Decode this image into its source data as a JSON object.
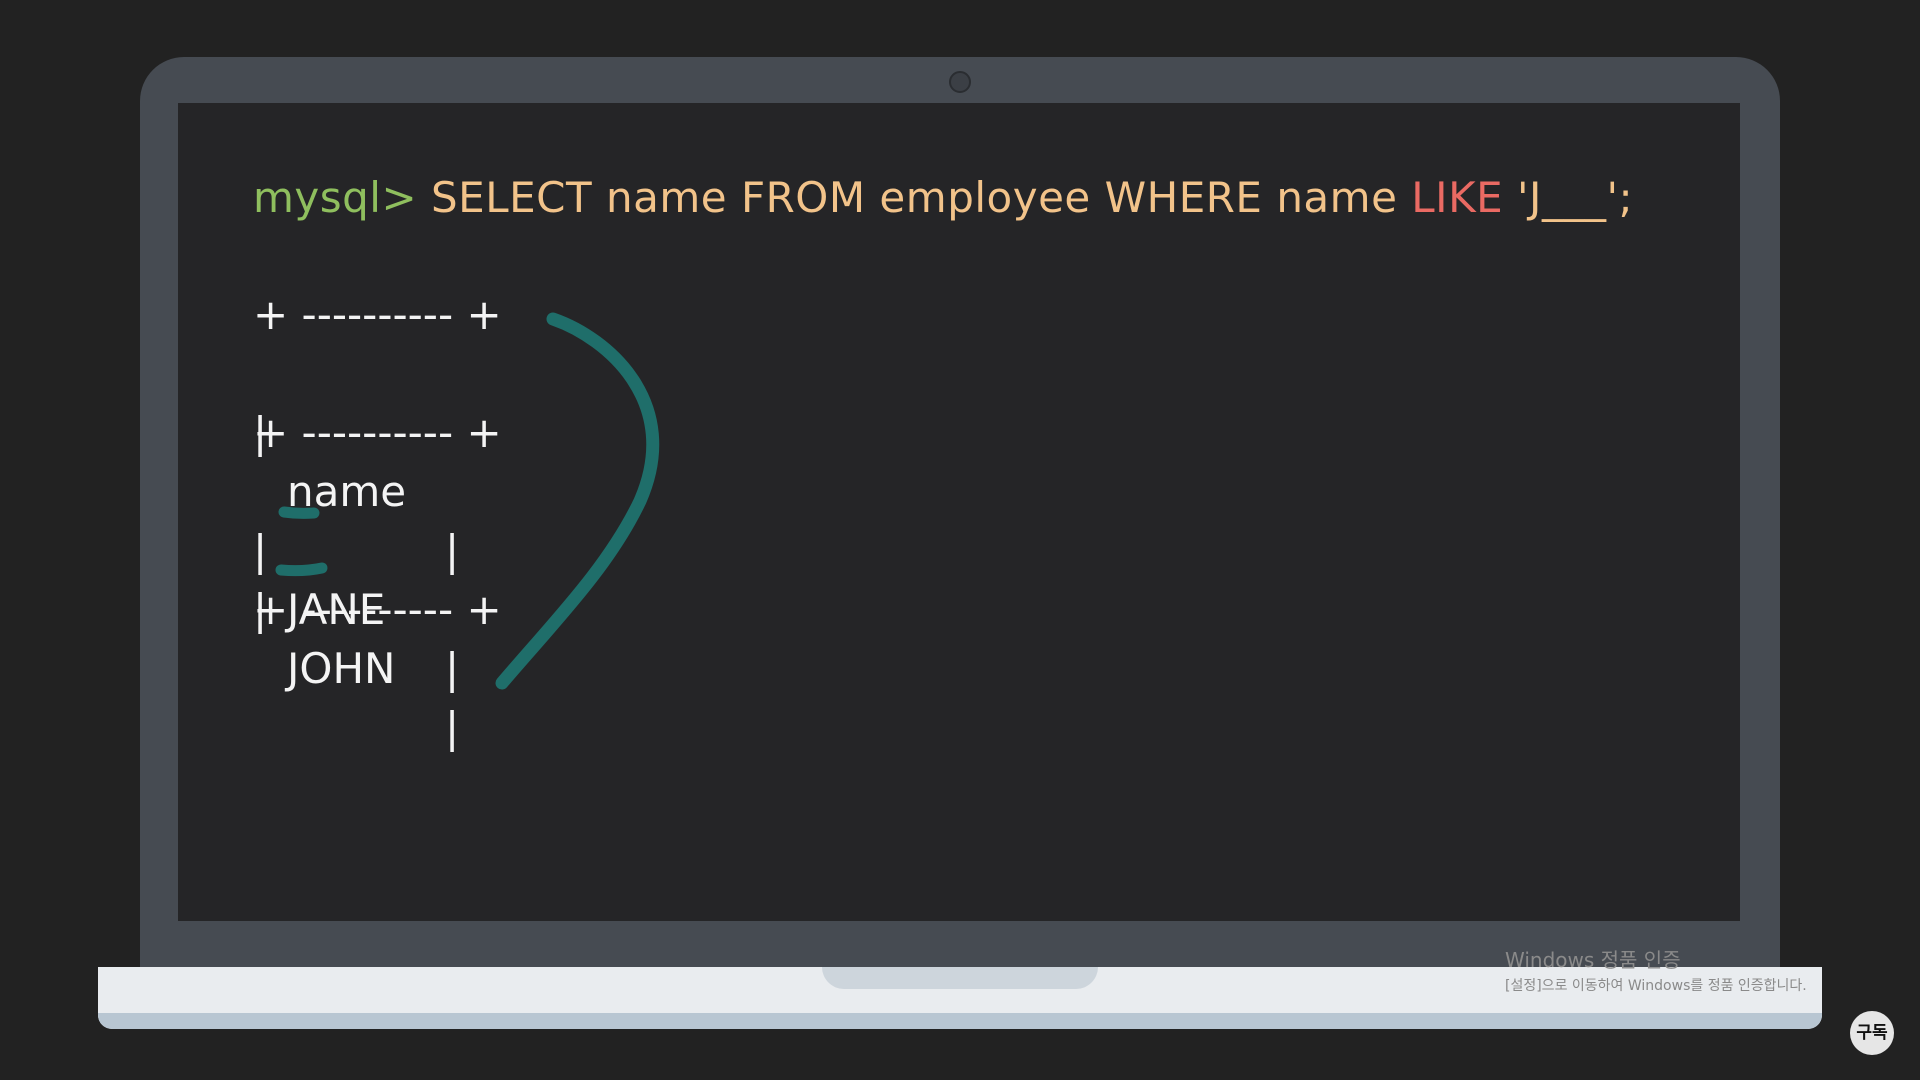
{
  "terminal": {
    "prompt": "mysql>",
    "query_part1": " SELECT name FROM employee WHERE name ",
    "keyword_like": "LIKE",
    "pattern": " 'J___';"
  },
  "result_table": {
    "border": "+ ---------- +",
    "pipe": "|",
    "header": "name",
    "rows": [
      "JANE",
      "JOHN"
    ]
  },
  "watermark": {
    "title": "Windows 정품 인증",
    "subtitle": "[설정]으로 이동하여 Windows를 정품 인증합니다."
  },
  "subscribe_badge": "구독",
  "colors": {
    "prompt": "#8fbf5e",
    "query": "#f2c38a",
    "keyword": "#ea6a63",
    "annotation": "#1f6e6a"
  }
}
